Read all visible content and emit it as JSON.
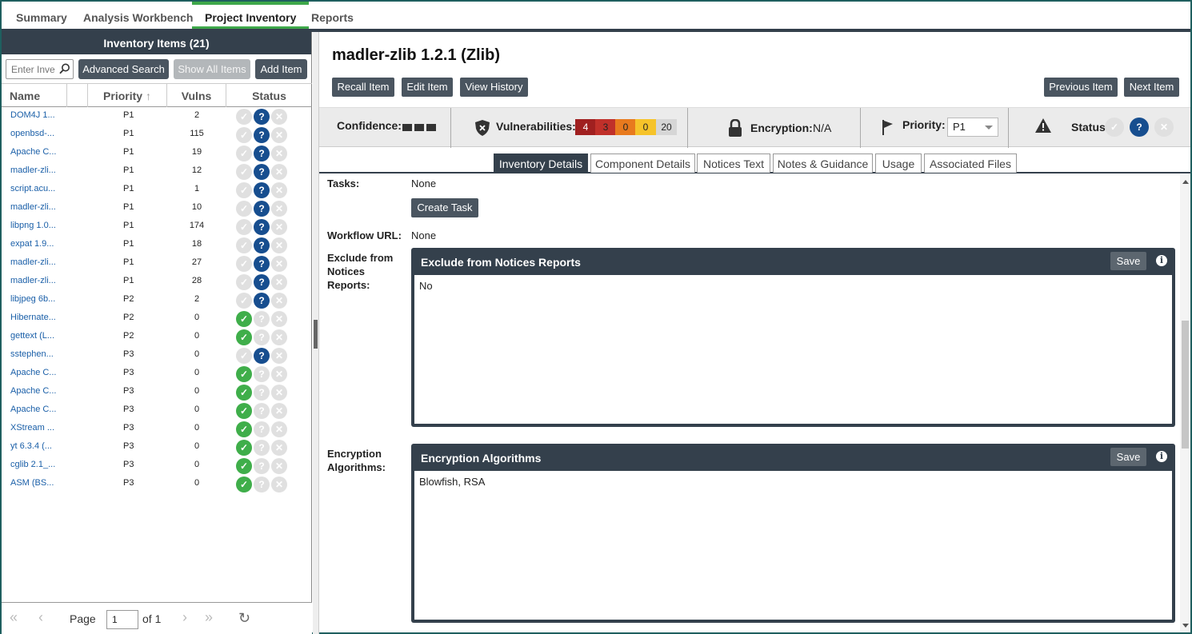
{
  "nav": {
    "tabs": [
      {
        "label": "Summary"
      },
      {
        "label": "Analysis Workbench"
      },
      {
        "label": "Project Inventory"
      },
      {
        "label": "Reports"
      }
    ]
  },
  "left": {
    "header": "Inventory Items (21)",
    "search_placeholder": "Enter Inve",
    "advanced_search": "Advanced Search",
    "show_all": "Show All Items",
    "add_item": "Add Item",
    "columns": {
      "name": "Name",
      "priority": "Priority",
      "vulns": "Vulns",
      "status": "Status"
    },
    "rows": [
      {
        "name": "DOM4J 1...",
        "priority": "P1",
        "vulns": "2",
        "status": "unknown"
      },
      {
        "name": "openbsd-...",
        "priority": "P1",
        "vulns": "115",
        "status": "unknown"
      },
      {
        "name": "Apache C...",
        "priority": "P1",
        "vulns": "19",
        "status": "unknown"
      },
      {
        "name": "madler-zli...",
        "priority": "P1",
        "vulns": "12",
        "status": "unknown"
      },
      {
        "name": "script.acu...",
        "priority": "P1",
        "vulns": "1",
        "status": "unknown"
      },
      {
        "name": "madler-zli...",
        "priority": "P1",
        "vulns": "10",
        "status": "unknown"
      },
      {
        "name": "libpng 1.0...",
        "priority": "P1",
        "vulns": "174",
        "status": "unknown"
      },
      {
        "name": "expat 1.9...",
        "priority": "P1",
        "vulns": "18",
        "status": "unknown"
      },
      {
        "name": "madler-zli...",
        "priority": "P1",
        "vulns": "27",
        "status": "unknown"
      },
      {
        "name": "madler-zli...",
        "priority": "P1",
        "vulns": "28",
        "status": "unknown"
      },
      {
        "name": "libjpeg 6b...",
        "priority": "P2",
        "vulns": "2",
        "status": "unknown"
      },
      {
        "name": "Hibernate...",
        "priority": "P2",
        "vulns": "0",
        "status": "approved"
      },
      {
        "name": "gettext (L...",
        "priority": "P2",
        "vulns": "0",
        "status": "approved"
      },
      {
        "name": "sstephen...",
        "priority": "P3",
        "vulns": "0",
        "status": "unknown"
      },
      {
        "name": "Apache C...",
        "priority": "P3",
        "vulns": "0",
        "status": "approved"
      },
      {
        "name": "Apache C...",
        "priority": "P3",
        "vulns": "0",
        "status": "approved"
      },
      {
        "name": "Apache C...",
        "priority": "P3",
        "vulns": "0",
        "status": "approved"
      },
      {
        "name": "XStream ...",
        "priority": "P3",
        "vulns": "0",
        "status": "approved"
      },
      {
        "name": "yt 6.3.4 (...",
        "priority": "P3",
        "vulns": "0",
        "status": "approved"
      },
      {
        "name": "cglib 2.1_...",
        "priority": "P3",
        "vulns": "0",
        "status": "approved"
      },
      {
        "name": "ASM (BS...",
        "priority": "P3",
        "vulns": "0",
        "status": "approved"
      }
    ],
    "pager": {
      "page_label": "Page",
      "page_value": "1",
      "of_label": "of 1"
    }
  },
  "right": {
    "title": "madler-zlib 1.2.1 (Zlib)",
    "buttons": {
      "recall": "Recall Item",
      "edit": "Edit Item",
      "history": "View History",
      "previous": "Previous Item",
      "next": "Next Item"
    },
    "info": {
      "confidence_label": "Confidence:",
      "vulnerabilities_label": "Vulnerabilities:",
      "vuln_counts": [
        "4",
        "3",
        "0",
        "0",
        "20"
      ],
      "encryption_label": "Encryption:",
      "encryption_value": "N/A",
      "priority_label": "Priority:",
      "priority_value": "P1",
      "status_label": "Status:"
    },
    "tabs": [
      "Inventory Details",
      "Component Details",
      "Notices Text",
      "Notes & Guidance",
      "Usage",
      "Associated Files"
    ],
    "fields": {
      "tasks_label": "Tasks:",
      "tasks_value": "None",
      "create_task": "Create Task",
      "workflow_label": "Workflow URL:",
      "workflow_value": "None",
      "exclude_label": "Exclude from Notices Reports:",
      "exclude_panel_title": "Exclude from Notices Reports",
      "exclude_value": "No",
      "encryption_label": "Encryption Algorithms:",
      "encryption_panel_title": "Encryption Algorithms",
      "encryption_value": "Blowfish, RSA",
      "save": "Save"
    }
  }
}
